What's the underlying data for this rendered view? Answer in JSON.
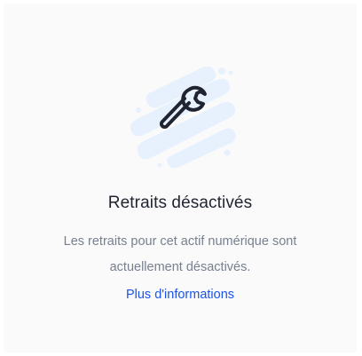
{
  "empty_state": {
    "title": "Retraits désactivés",
    "description": "Les retraits pour cet actif numérique sont actuellement désactivés.",
    "link_label": "Plus d'informations",
    "icon": "wrench-icon",
    "accent_color": "#1a54e8",
    "splash_color": "#e6f1fd"
  }
}
